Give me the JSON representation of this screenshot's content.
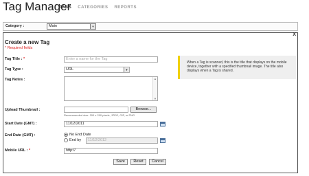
{
  "app": {
    "title": "Tag Manager"
  },
  "nav": {
    "tabs": [
      {
        "label": "TAGS",
        "active": true
      },
      {
        "label": "CATEGORIES",
        "active": false
      },
      {
        "label": "REPORTS",
        "active": false
      }
    ]
  },
  "category": {
    "label": "Category :",
    "selected": "Main"
  },
  "panel": {
    "close": "X",
    "title": "Create a new Tag",
    "required_note": "* Required fields"
  },
  "form": {
    "tag_title": {
      "label": "Tag Title :",
      "required": "*",
      "placeholder": "Enter a name for the Tag"
    },
    "tag_type": {
      "label": "Tag Type :",
      "selected": "URL"
    },
    "tag_notes": {
      "label": "Tag Notes :"
    },
    "upload_thumbnail": {
      "label": "Upload Thumbnail :",
      "browse_label": "Browse...",
      "hint": "Recommended size: 200 x 200 pixels, JPEG, GIF, or PNG"
    },
    "start_date": {
      "label": "Start Date (GMT) :",
      "value": "11/12/2011"
    },
    "end_date": {
      "label": "End Date (GMT) :",
      "options": [
        {
          "label": "No End Date",
          "checked": true
        },
        {
          "label": "End by",
          "checked": false
        }
      ],
      "end_by_value": "11/12/2012"
    },
    "mobile_url": {
      "label": "Mobile URL :",
      "required": "*",
      "value": "http://"
    },
    "buttons": {
      "save": "Save",
      "reset": "Reset",
      "cancel": "Cancel"
    }
  },
  "info": {
    "text": "When a Tag is scanned, this is the title that displays on the mobile device, together with a specified thumbnail image. The title also displays when a Tag is shared.",
    "accent_color": "#f0d000"
  },
  "icons": {
    "calendar": "calendar-icon",
    "dropdown": "chevron-down-icon",
    "close": "close-icon"
  }
}
